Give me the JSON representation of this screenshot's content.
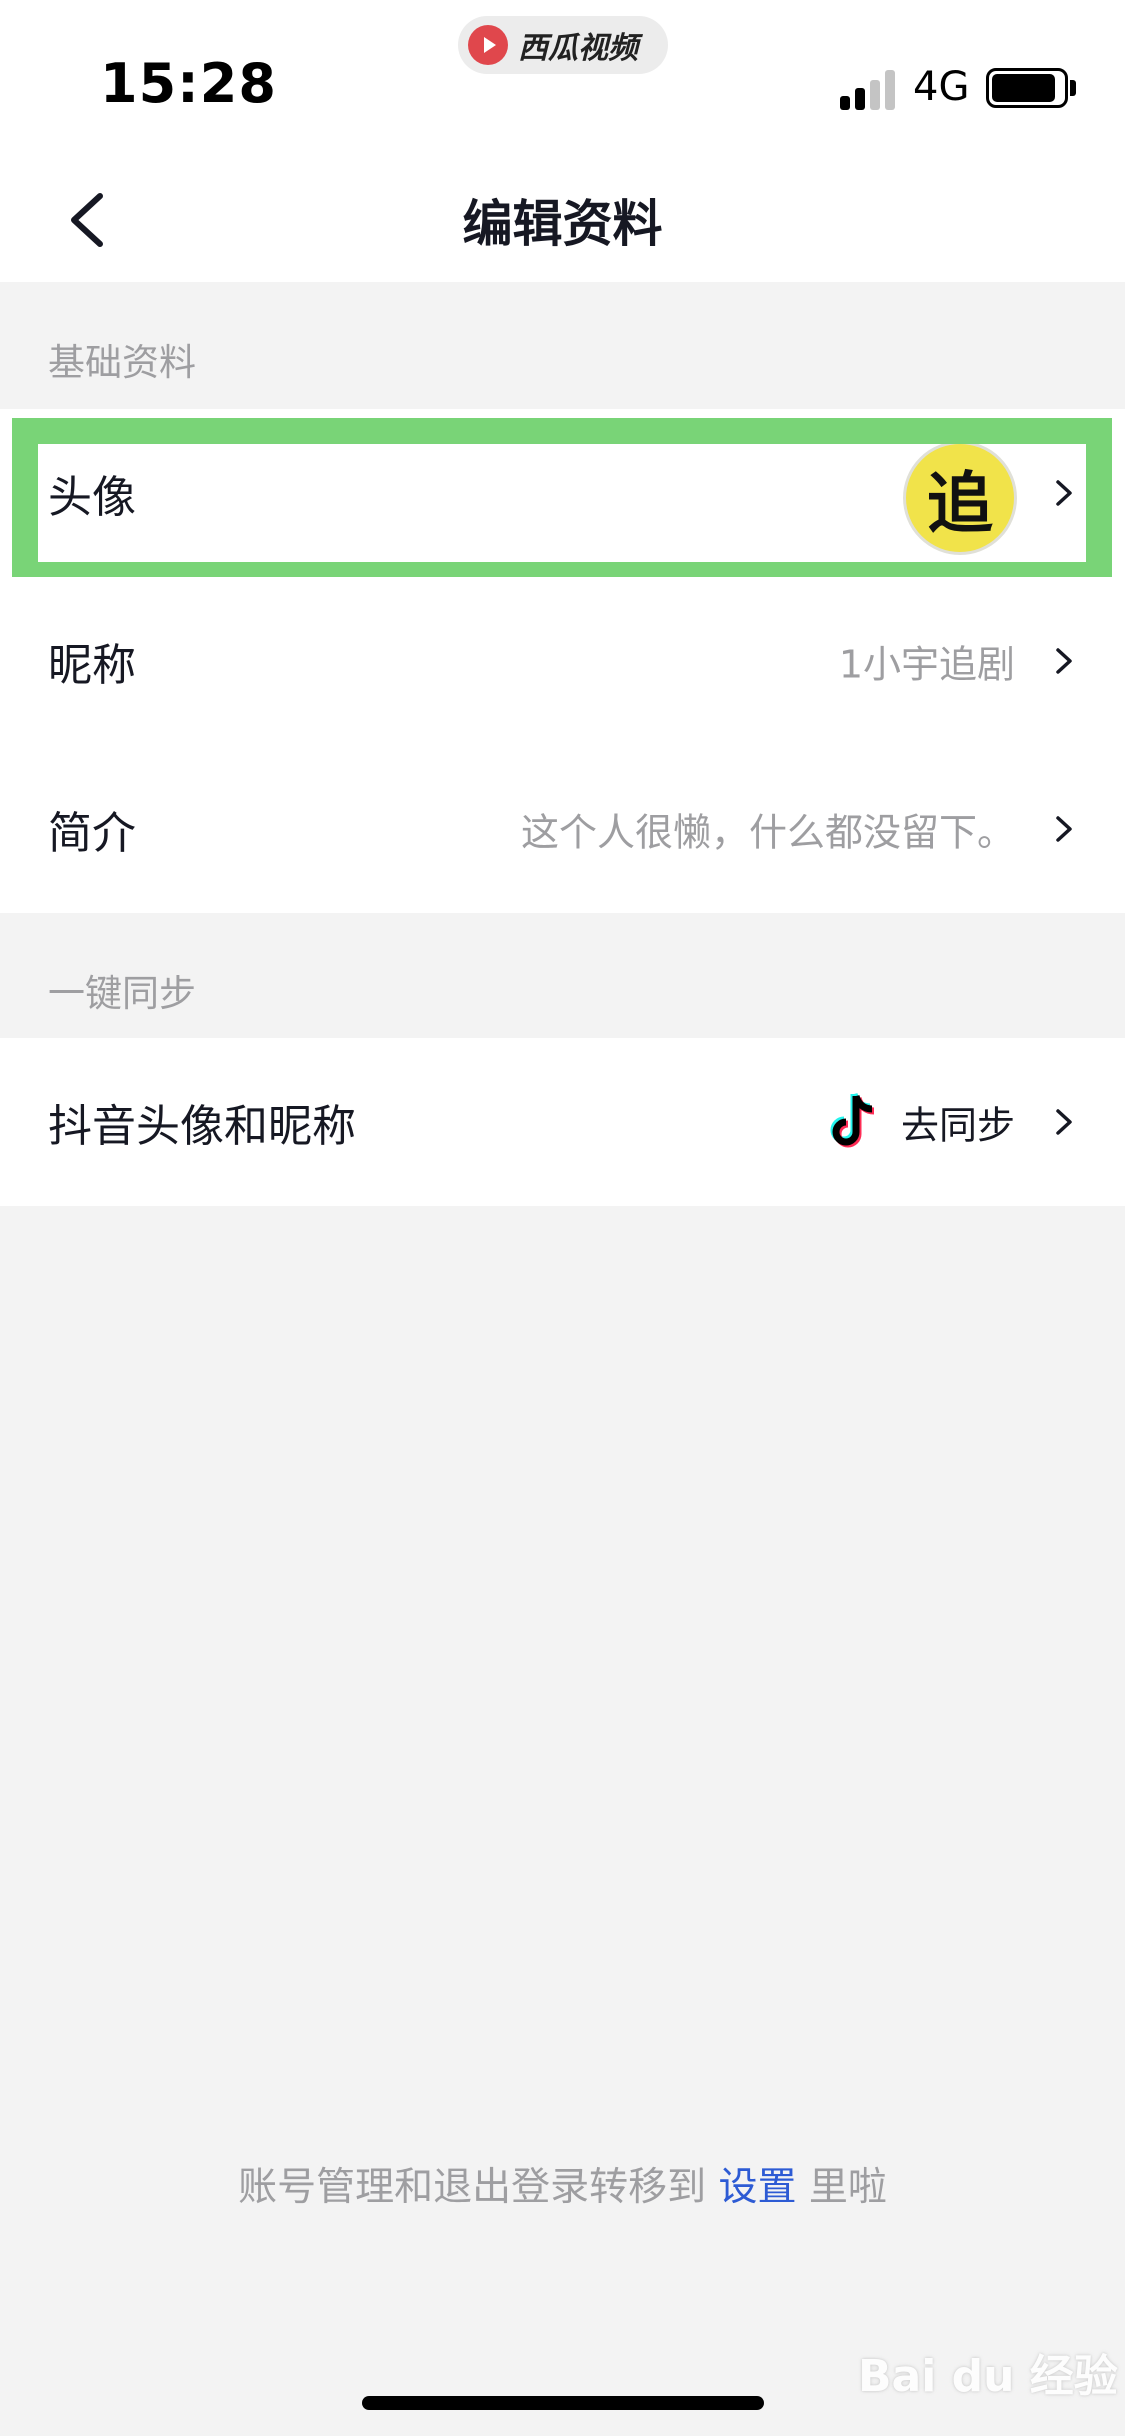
{
  "status_bar": {
    "time": "15:28",
    "app_name": "西瓜视频",
    "network": "4G",
    "battery_percent": 90
  },
  "nav": {
    "title": "编辑资料"
  },
  "sections": {
    "basic": {
      "label": "基础资料",
      "rows": [
        {
          "label": "头像",
          "value": "",
          "avatar_char": "追"
        },
        {
          "label": "昵称",
          "value": "1小宇追剧"
        },
        {
          "label": "简介",
          "value": "这个人很懒，什么都没留下。"
        }
      ]
    },
    "sync": {
      "label": "一键同步",
      "rows": [
        {
          "label": "抖音头像和昵称",
          "value": "去同步"
        }
      ]
    }
  },
  "footer": {
    "note_prefix": "账号管理和退出登录转移到",
    "link_text": "设置",
    "note_suffix": "里啦"
  },
  "watermark": "Bai du 经验",
  "colors": {
    "highlight": "#79d477",
    "link": "#2d5bd4",
    "background": "#f3f3f3"
  }
}
